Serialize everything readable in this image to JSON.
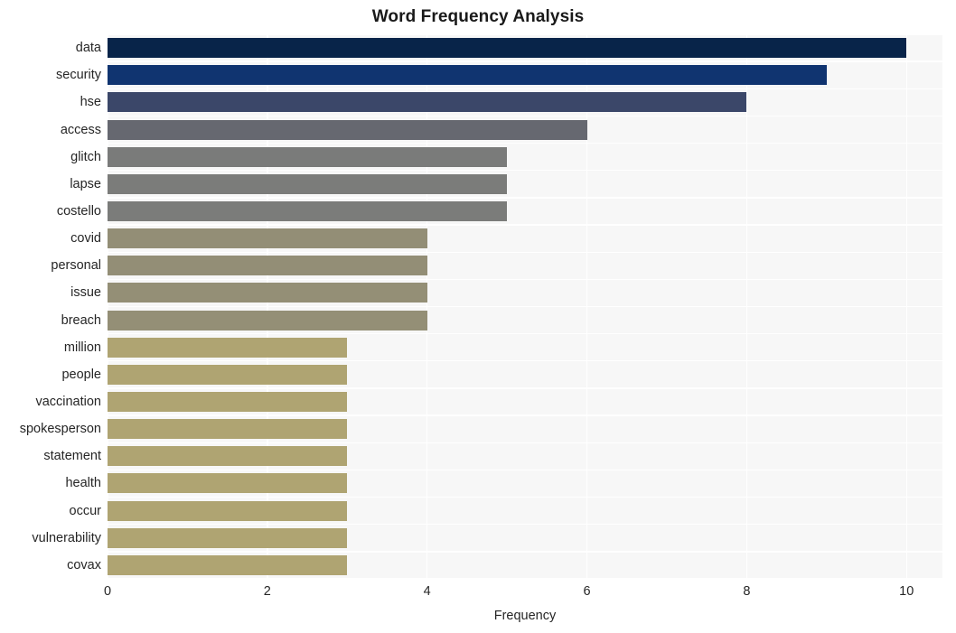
{
  "chart_data": {
    "type": "bar",
    "orientation": "horizontal",
    "title": "Word Frequency Analysis",
    "xlabel": "Frequency",
    "ylabel": "",
    "xlim": [
      0,
      10.45
    ],
    "ylim": [
      0,
      20
    ],
    "xticks": [
      0,
      2,
      4,
      6,
      8,
      10
    ],
    "xtick_labels": [
      "0",
      "2",
      "4",
      "6",
      "8",
      "10"
    ],
    "grid": true,
    "legend": null,
    "categories": [
      "data",
      "security",
      "hse",
      "access",
      "glitch",
      "lapse",
      "costello",
      "covid",
      "personal",
      "issue",
      "breach",
      "million",
      "people",
      "vaccination",
      "spokesperson",
      "statement",
      "health",
      "occur",
      "vulnerability",
      "covax"
    ],
    "values": [
      10,
      9,
      8,
      6,
      5,
      5,
      5,
      4,
      4,
      4,
      4,
      3,
      3,
      3,
      3,
      3,
      3,
      3,
      3,
      3
    ],
    "bar_colors": [
      "#082449",
      "#103470",
      "#3b4769",
      "#666870",
      "#7a7b7a",
      "#7b7c7a",
      "#7b7c7a",
      "#938e76",
      "#938e76",
      "#948f76",
      "#948f76",
      "#afa472",
      "#afa472",
      "#afa472",
      "#afa472",
      "#afa472",
      "#afa472",
      "#afa472",
      "#afa472",
      "#afa472"
    ]
  },
  "style": {
    "figure_background": "#ffffff",
    "plot_background": "#f7f7f7",
    "gridline_color": "#ffffff",
    "text_color": "#262626",
    "title_color": "#1a1a1a"
  }
}
